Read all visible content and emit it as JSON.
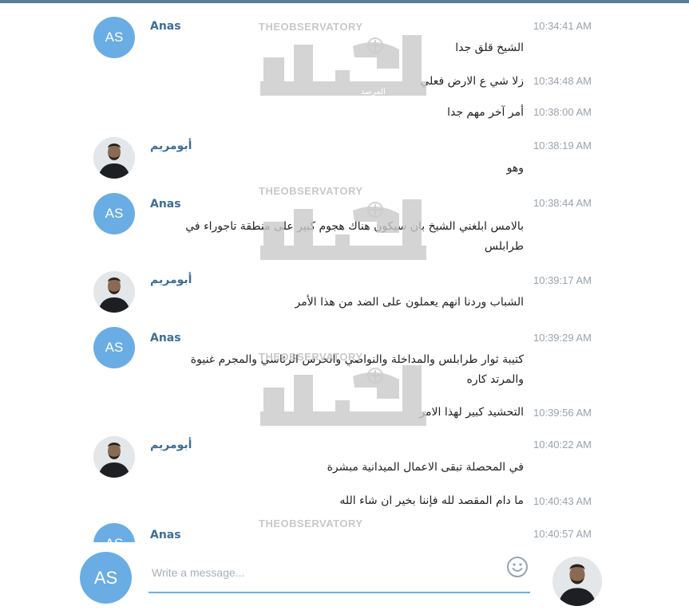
{
  "users": {
    "anas": {
      "name": "Anas",
      "initials": "AS"
    },
    "abu": {
      "name": "أبومريم"
    }
  },
  "watermark": {
    "brand": "THEOBSERVATORY",
    "arabic": "المرصد"
  },
  "messages": [
    {
      "sender": "Anas",
      "time": "10:34:41 AM",
      "text": "الشيخ قلق جدا"
    },
    {
      "time": "10:34:48 AM",
      "text": "زلا شي ع الارض فعلي"
    },
    {
      "time": "10:38:00 AM",
      "text": "أمر آخر مهم جدا"
    },
    {
      "sender": "أبومريم",
      "time": "10:38:19 AM",
      "text": "وهو"
    },
    {
      "sender": "Anas",
      "time": "10:38:44 AM",
      "text": "بالامس ابلغني الشيخ بان سيكون هناك هجوم كبير على منطقة تاجوراء في طرابلس"
    },
    {
      "sender": "أبومريم",
      "time": "10:39:17 AM",
      "text": "الشباب وردنا انهم يعملون على الضد من هذا الأمر"
    },
    {
      "sender": "Anas",
      "time": "10:39:29 AM",
      "text": "كتيبة ثوار طرابلس والمداخلة والنواصي والحرس الرئاسي والمجرم غنيوة والمرتد كاره"
    },
    {
      "time": "10:39:56 AM",
      "text": "التحشيد كبير لهذا الامر"
    },
    {
      "sender": "أبومريم",
      "time": "10:40:22 AM",
      "text": "في المحصلة تبقى الاعمال الميدانية مبشرة"
    },
    {
      "time": "10:40:43 AM",
      "text": "ما دام المقصد لله فإننا بخير ان شاء الله"
    },
    {
      "sender": "Anas",
      "time": "10:40:57 AM",
      "text": ""
    }
  ],
  "composer": {
    "placeholder": "Write a message...",
    "value": "",
    "emoji_icon": "smiley-icon"
  },
  "colors": {
    "accent": "#6aade4",
    "sender": "#3e6d94",
    "timestamp": "#9aa3ab",
    "topbar": "#5b7a99"
  }
}
